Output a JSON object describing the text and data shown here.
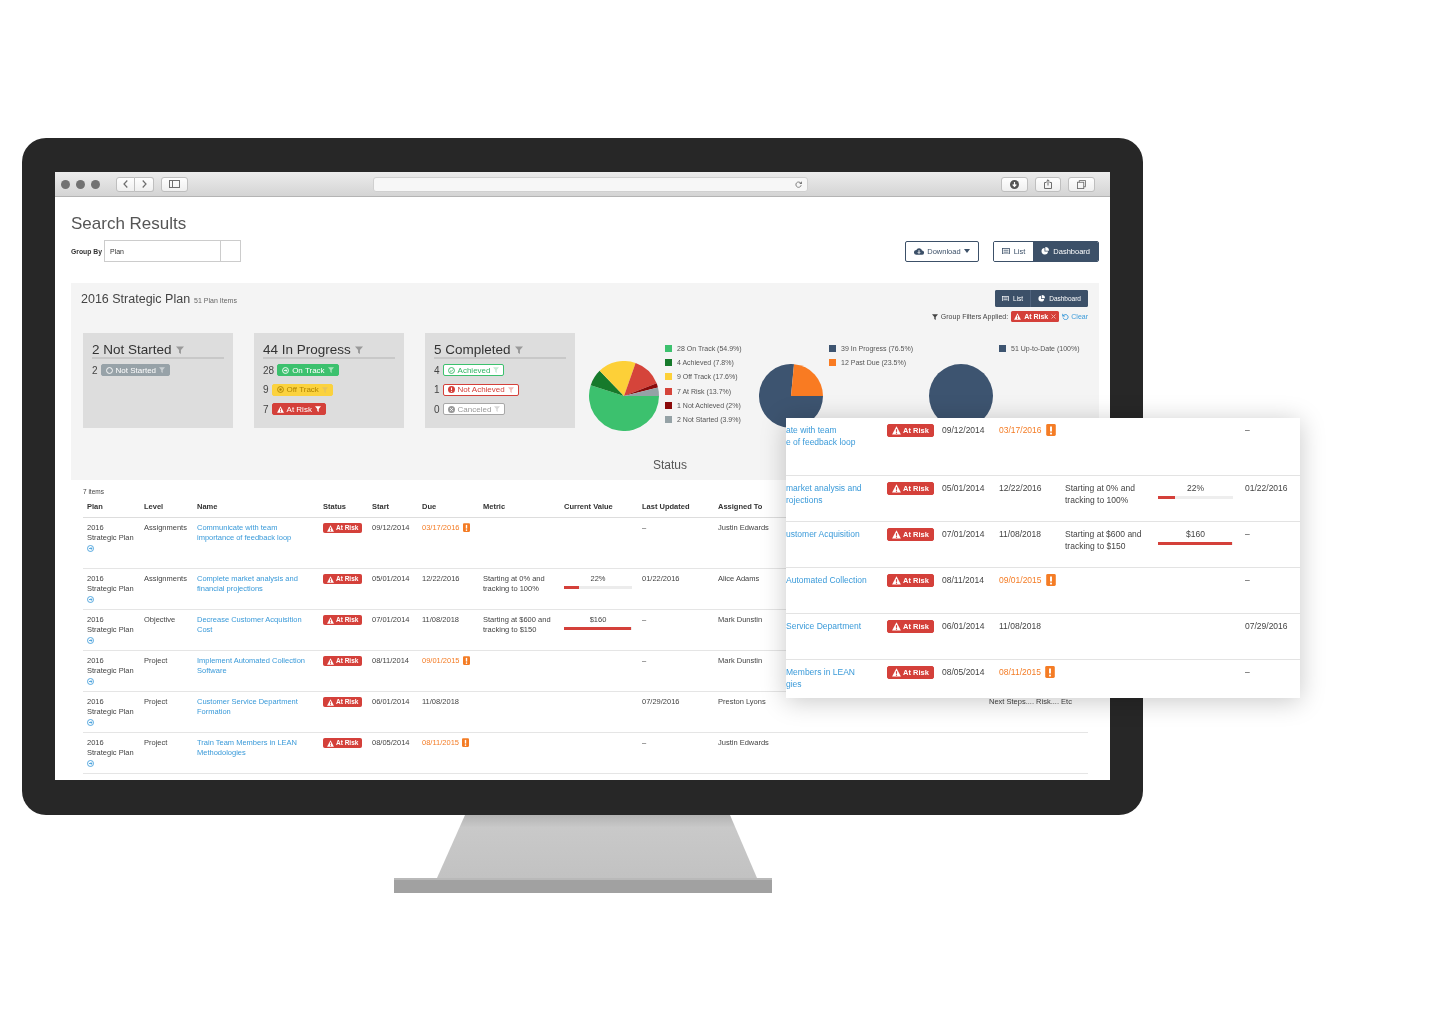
{
  "page": {
    "title": "Search Results",
    "group_by": {
      "label": "Group By",
      "value": "Plan"
    },
    "download_button": {
      "label": "Download"
    },
    "view_toggle": [
      {
        "label": "List",
        "kind": "list",
        "selected": false
      },
      {
        "label": "Dashboard",
        "kind": "dashboard",
        "selected": true
      }
    ]
  },
  "panel": {
    "title": "2016 Strategic Plan",
    "count": "51 Plan Items",
    "view_buttons": [
      {
        "label": "List",
        "kind": "list"
      },
      {
        "label": "Dashboard",
        "kind": "dashboard"
      }
    ],
    "filters": {
      "label": "Group Filters Applied:",
      "chips": [
        {
          "label": "At Risk",
          "kind": "at_risk"
        }
      ],
      "clear_link": "Clear"
    },
    "status_cards": [
      {
        "title": "2 Not Started",
        "items": [
          {
            "count": "2",
            "label": "Not Started",
            "kind": "not_started"
          }
        ]
      },
      {
        "title": "44 In Progress",
        "items": [
          {
            "count": "28",
            "label": "On Track",
            "kind": "on_track"
          },
          {
            "count": "9",
            "label": "Off Track",
            "kind": "off_track"
          },
          {
            "count": "7",
            "label": "At Risk",
            "kind": "at_risk"
          }
        ]
      },
      {
        "title": "5 Completed",
        "items": [
          {
            "count": "4",
            "label": "Achieved",
            "kind": "achieved"
          },
          {
            "count": "1",
            "label": "Not Achieved",
            "kind": "not_achieved"
          },
          {
            "count": "0",
            "label": "Canceled",
            "kind": "canceled"
          }
        ]
      }
    ],
    "charts": [
      {
        "legend": [
          {
            "label": "28 On Track (54.9%)",
            "color": "#3cc16e"
          },
          {
            "label": "4 Achieved (7.8%)",
            "color": "#167a2b"
          },
          {
            "label": "9 Off Track (17.6%)",
            "color": "#fdd038"
          },
          {
            "label": "7 At Risk (13.7%)",
            "color": "#d5443a"
          },
          {
            "label": "1 Not Achieved (2%)",
            "color": "#8b0a0a"
          },
          {
            "label": "2 Not Started (3.9%)",
            "color": "#95a2a6"
          }
        ],
        "chart_data": {
          "type": "pie",
          "title": "Status",
          "values": [
            54.9,
            7.8,
            17.6,
            13.7,
            2,
            3.9
          ]
        }
      },
      {
        "legend": [
          {
            "label": "39 In Progress (76.5%)",
            "color": "#3d5470"
          },
          {
            "label": "12 Past Due (23.5%)",
            "color": "#f97b22"
          }
        ],
        "chart_data": {
          "type": "pie",
          "values": [
            76.5,
            23.5
          ]
        }
      },
      {
        "legend": [
          {
            "label": "51 Up-to-Date (100%)",
            "color": "#3d5470"
          }
        ],
        "chart_data": {
          "type": "pie",
          "values": [
            100
          ]
        }
      }
    ]
  },
  "table": {
    "count": "7 items",
    "columns": [
      "Plan",
      "Level",
      "Name",
      "Status",
      "Start",
      "Due",
      "Metric",
      "Current Value",
      "Last Updated",
      "Assigned To"
    ],
    "rows": [
      {
        "plan": "2016 Strategic Plan",
        "level_label": "Assignments",
        "name": "Communicate with team importance of feedback loop",
        "status": {
          "label": "At Risk",
          "kind": "at_risk"
        },
        "start": "09/12/2014",
        "due": "03/17/2016",
        "overdue": true,
        "last_updated": "–",
        "assigned_to": "Justin Edwards"
      },
      {
        "plan": "2016 Strategic Plan",
        "level_label": "Assignments",
        "name": "Complete market analysis and financial projections",
        "status": {
          "label": "At Risk",
          "kind": "at_risk"
        },
        "start": "05/01/2014",
        "due": "12/22/2016",
        "overdue": false,
        "metric": "Starting at 0% and tracking to 100%",
        "current_value": {
          "text": "22%",
          "level": 0.22
        },
        "last_updated": "01/22/2016",
        "assigned_to": "Alice Adams"
      },
      {
        "plan": "2016 Strategic Plan",
        "level_label": "Objective",
        "name": "Decrease Customer Acquisition Cost",
        "status": {
          "label": "At Risk",
          "kind": "at_risk"
        },
        "start": "07/01/2014",
        "due": "11/08/2018",
        "overdue": false,
        "metric": "Starting at $600 and tracking to $150",
        "current_value": {
          "text": "$160",
          "level": 0.98
        },
        "last_updated": "–",
        "assigned_to": "Mark Dunstin"
      },
      {
        "plan": "2016 Strategic Plan",
        "level_label": "Project",
        "name": "Implement Automated Collection Software",
        "status": {
          "label": "At Risk",
          "kind": "at_risk"
        },
        "start": "08/11/2014",
        "due": "09/01/2015",
        "overdue": true,
        "last_updated": "–",
        "assigned_to": "Mark Dunstin"
      },
      {
        "plan": "2016 Strategic Plan",
        "level_label": "Project",
        "name": "Customer Service Department Formation",
        "status": {
          "label": "At Risk",
          "kind": "at_risk"
        },
        "start": "06/01/2014",
        "due": "11/08/2018",
        "overdue": false,
        "last_updated": "07/29/2016",
        "assigned_to": "Preston Lyons",
        "column_11": "Next Steps.... Risk.... Etc"
      },
      {
        "plan": "2016 Strategic Plan",
        "level_label": "Project",
        "name": "Train Team Members in LEAN Methodologies",
        "status": {
          "label": "At Risk",
          "kind": "at_risk"
        },
        "start": "08/05/2014",
        "due": "08/11/2015",
        "overdue": true,
        "last_updated": "–",
        "assigned_to": "Justin Edwards"
      }
    ]
  },
  "magnified_view": {
    "rows": [
      {
        "name_lines": [
          "ate with team",
          "e of feedback loop"
        ],
        "status": {
          "label": "At Risk",
          "kind": "at_risk"
        },
        "start": "09/12/2014",
        "due": "03/17/2016",
        "overdue": true,
        "last_updated": "–"
      },
      {
        "name_lines": [
          "market analysis and",
          "rojections"
        ],
        "status": {
          "label": "At Risk",
          "kind": "at_risk"
        },
        "start": "05/01/2014",
        "due": "12/22/2016",
        "overdue": false,
        "metric": "Starting at 0% and tracking to 100%",
        "current_value": {
          "text": "22%",
          "level": 0.22
        },
        "last_updated": "01/22/2016"
      },
      {
        "name_lines": [
          "ustomer Acquisition"
        ],
        "status": {
          "label": "At Risk",
          "kind": "at_risk"
        },
        "start": "07/01/2014",
        "due": "11/08/2018",
        "overdue": false,
        "metric": "Starting at $600 and tracking to $150",
        "current_value": {
          "text": "$160",
          "level": 0.98
        },
        "last_updated": "–"
      },
      {
        "name_lines": [
          "Automated Collection"
        ],
        "status": {
          "label": "At Risk",
          "kind": "at_risk"
        },
        "start": "08/11/2014",
        "due": "09/01/2015",
        "overdue": true,
        "last_updated": "–"
      },
      {
        "name_lines": [
          "Service Department"
        ],
        "status": {
          "label": "At Risk",
          "kind": "at_risk"
        },
        "start": "06/01/2014",
        "due": "11/08/2018",
        "overdue": false,
        "last_updated": "07/29/2016"
      },
      {
        "name_lines": [
          "Members in LEAN",
          "gies"
        ],
        "status": {
          "label": "At Risk",
          "kind": "at_risk"
        },
        "start": "08/05/2014",
        "due": "08/11/2015",
        "overdue": true,
        "last_updated": "–"
      }
    ]
  }
}
